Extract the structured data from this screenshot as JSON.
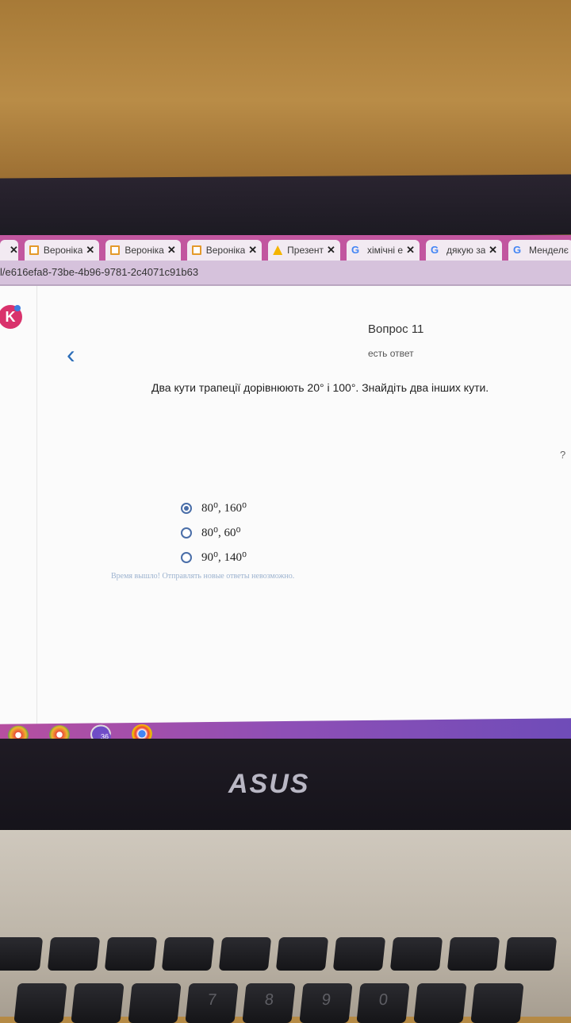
{
  "browser": {
    "tabs": [
      {
        "label": "",
        "icon": "none"
      },
      {
        "label": "Вероніка",
        "icon": "doc-icon"
      },
      {
        "label": "Вероніка",
        "icon": "doc-icon"
      },
      {
        "label": "Вероніка",
        "icon": "doc-icon"
      },
      {
        "label": "Презент",
        "icon": "slides-icon"
      },
      {
        "label": "хімічні е",
        "icon": "google-icon"
      },
      {
        "label": "дякую за",
        "icon": "google-icon"
      },
      {
        "label": "Менделє",
        "icon": "google-icon"
      }
    ],
    "close_symbol": "✕",
    "url": "l/e616efa8-73be-4b96-9781-2c4071c91b63"
  },
  "app": {
    "logo_letter": "K"
  },
  "quiz": {
    "question_number": "Вопрос 11",
    "status": "есть ответ",
    "question_text": "Два кути трапеції дорівнюють 20° і 100°. Знайдіть два інших кути.",
    "help_symbol": "?",
    "options": [
      {
        "text": "80⁰, 160⁰",
        "selected": true
      },
      {
        "text": "80⁰, 60⁰",
        "selected": false
      },
      {
        "text": "90⁰, 140⁰",
        "selected": false
      }
    ],
    "notice": "Время вышло! Отправлять новые ответы невозможно."
  },
  "taskbar": {
    "viber_badge": "36"
  },
  "laptop": {
    "brand": "ASUS",
    "number_keys": [
      "7",
      "8",
      "9",
      "0"
    ]
  },
  "colors": {
    "tabbar": "#c2569f",
    "accent": "#2b6db8",
    "radio": "#4a6ea8",
    "logo": "#d9326c"
  }
}
